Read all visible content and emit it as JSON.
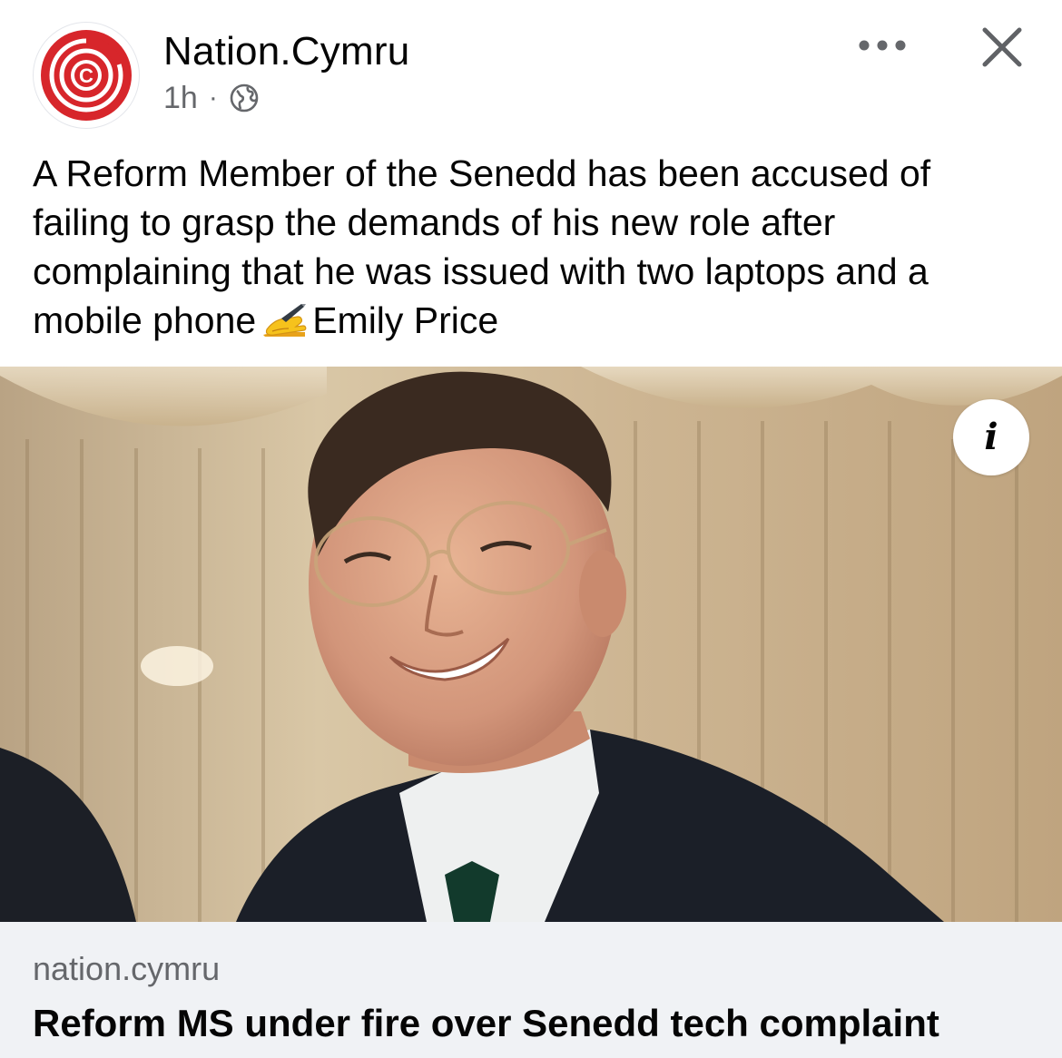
{
  "header": {
    "author": "Nation.Cymru",
    "time": "1h",
    "separator": "·",
    "audience_icon": "globe-icon",
    "logo_icon": "nation-cymru-logo",
    "more_icon": "more-options-icon",
    "close_icon": "close-icon"
  },
  "post": {
    "text": "A Reform Member of the Senedd has been accused of failing to grasp the demands of his new role after complaining that he was issued with two laptops and a mobile phone",
    "emoji_icon": "writing-hand-emoji",
    "byline": "Emily Price"
  },
  "media": {
    "info_label": "i",
    "info_icon": "info-icon"
  },
  "link_preview": {
    "domain": "nation.cymru",
    "title": "Reform MS under fire over Senedd tech complaint"
  },
  "colors": {
    "brand_red": "#d7262b",
    "secondary_text": "#65676b",
    "primary_text": "#050505",
    "link_bg": "#f0f2f5"
  }
}
